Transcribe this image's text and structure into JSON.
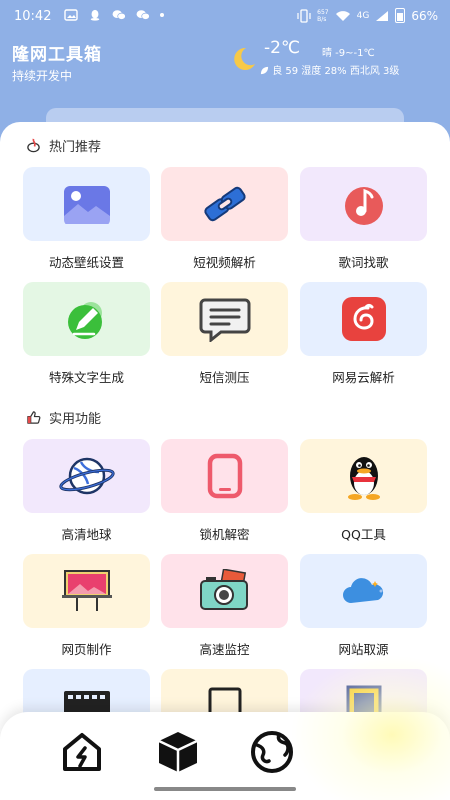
{
  "status_bar": {
    "time": "10:42",
    "net_speed": "657\nB/s",
    "network": "4G",
    "battery": "66%"
  },
  "header": {
    "title": "隆网工具箱",
    "subtitle": "持续开发中"
  },
  "weather": {
    "temperature": "-2℃",
    "condition": "晴 -9~-1℃",
    "details": "良 59 湿度 28% 西北风 3级"
  },
  "sections": [
    {
      "title": "热门推荐",
      "items": [
        {
          "label": "动态壁纸设置",
          "icon": "wallpaper-icon"
        },
        {
          "label": "短视频解析",
          "icon": "link-icon"
        },
        {
          "label": "歌词找歌",
          "icon": "music-icon"
        },
        {
          "label": "特殊文字生成",
          "icon": "pencil-icon"
        },
        {
          "label": "短信测压",
          "icon": "message-icon"
        },
        {
          "label": "网易云解析",
          "icon": "netease-icon"
        }
      ]
    },
    {
      "title": "实用功能",
      "items": [
        {
          "label": "高清地球",
          "icon": "planet-icon"
        },
        {
          "label": "锁机解密",
          "icon": "phone-icon"
        },
        {
          "label": "QQ工具",
          "icon": "qq-penguin-icon"
        },
        {
          "label": "网页制作",
          "icon": "billboard-icon"
        },
        {
          "label": "高速监控",
          "icon": "camera-icon"
        },
        {
          "label": "网站取源",
          "icon": "cloud-icon"
        }
      ]
    }
  ],
  "bottom_nav": [
    "home-icon",
    "box-icon",
    "globe-icon"
  ]
}
